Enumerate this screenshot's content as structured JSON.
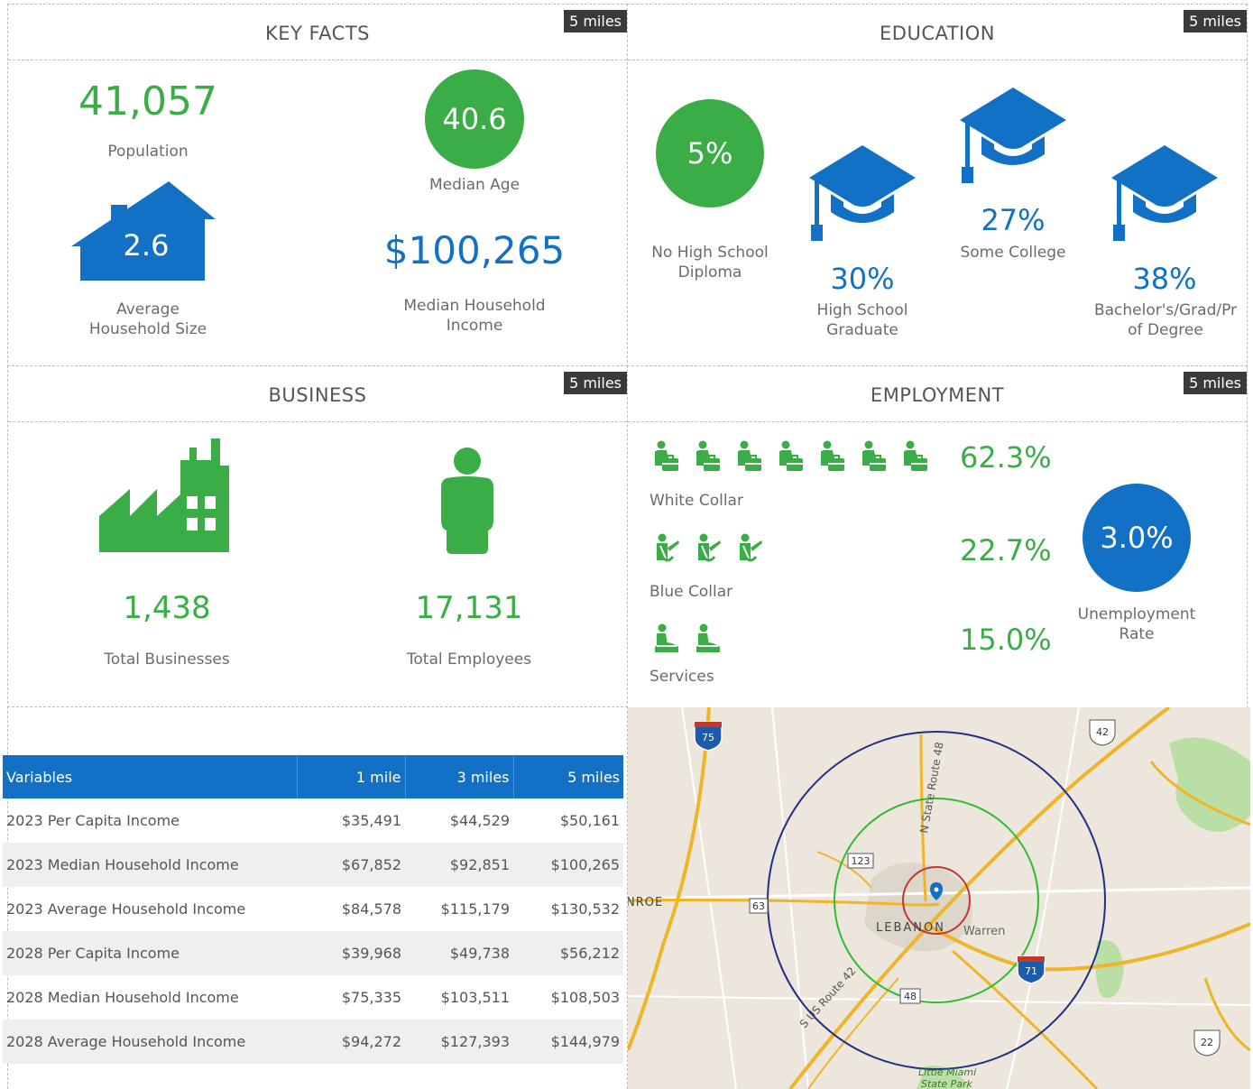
{
  "key_facts": {
    "title": "KEY FACTS",
    "badge": "5 miles",
    "population_value": "41,057",
    "population_label": "Population",
    "median_age_value": "40.6",
    "median_age_label": "Median Age",
    "household_size_value": "2.6",
    "household_size_label_1": "Average",
    "household_size_label_2": "Household Size",
    "income_value": "$100,265",
    "income_label_1": "Median Household",
    "income_label_2": "Income"
  },
  "education": {
    "title": "EDUCATION",
    "badge": "5 miles",
    "no_hs_value": "5%",
    "no_hs_label_1": "No High School",
    "no_hs_label_2": "Diploma",
    "hs_value": "30%",
    "hs_label_1": "High School",
    "hs_label_2": "Graduate",
    "college_value": "27%",
    "college_label": "Some College",
    "bachelor_value": "38%",
    "bachelor_label_1": "Bachelor's/Grad/Pr",
    "bachelor_label_2": "of Degree"
  },
  "business": {
    "title": "BUSINESS",
    "badge": "5 miles",
    "businesses_value": "1,438",
    "businesses_label": "Total Businesses",
    "employees_value": "17,131",
    "employees_label": "Total Employees"
  },
  "employment": {
    "title": "EMPLOYMENT",
    "badge": "5 miles",
    "white_collar_value": "62.3%",
    "white_collar_label": "White Collar",
    "white_collar_icons": 7,
    "blue_collar_value": "22.7%",
    "blue_collar_label": "Blue Collar",
    "blue_collar_icons": 3,
    "services_value": "15.0%",
    "services_label": "Services",
    "services_icons": 2,
    "unemployment_value": "3.0%",
    "unemployment_label_1": "Unemployment",
    "unemployment_label_2": "Rate"
  },
  "table": {
    "headers": [
      "Variables",
      "1 mile",
      "3 miles",
      "5 miles"
    ],
    "rows": [
      [
        "2023 Per Capita Income",
        "$35,491",
        "$44,529",
        "$50,161"
      ],
      [
        "2023 Median Household Income",
        "$67,852",
        "$92,851",
        "$100,265"
      ],
      [
        "2023 Average Household Income",
        "$84,578",
        "$115,179",
        "$130,532"
      ],
      [
        "2028 Per Capita Income",
        "$39,968",
        "$49,738",
        "$56,212"
      ],
      [
        "2028 Median Household Income",
        "$75,335",
        "$103,511",
        "$108,503"
      ],
      [
        "2028 Average Household Income",
        "$94,272",
        "$127,393",
        "$144,979"
      ]
    ]
  },
  "map": {
    "city_label": "LEBANON",
    "warren_label": "Warren",
    "monroe_label": "NROE",
    "route_48_label": "N State Route 48",
    "route_42_label": "S US Route 42",
    "park_label_1": "Little Miami",
    "park_label_2": "State Park",
    "shields": {
      "i75": "75",
      "i71": "71",
      "us42": "42",
      "us22": "22",
      "sr123": "123",
      "sr63": "63",
      "sr48": "48"
    },
    "ring_colors": {
      "inner": "#c0392b",
      "middle": "#2ebd2e",
      "outer": "#1e2f86"
    }
  },
  "colors": {
    "green": "#3bad46",
    "blue": "#1271c4",
    "badge": "#3a3a3a"
  }
}
